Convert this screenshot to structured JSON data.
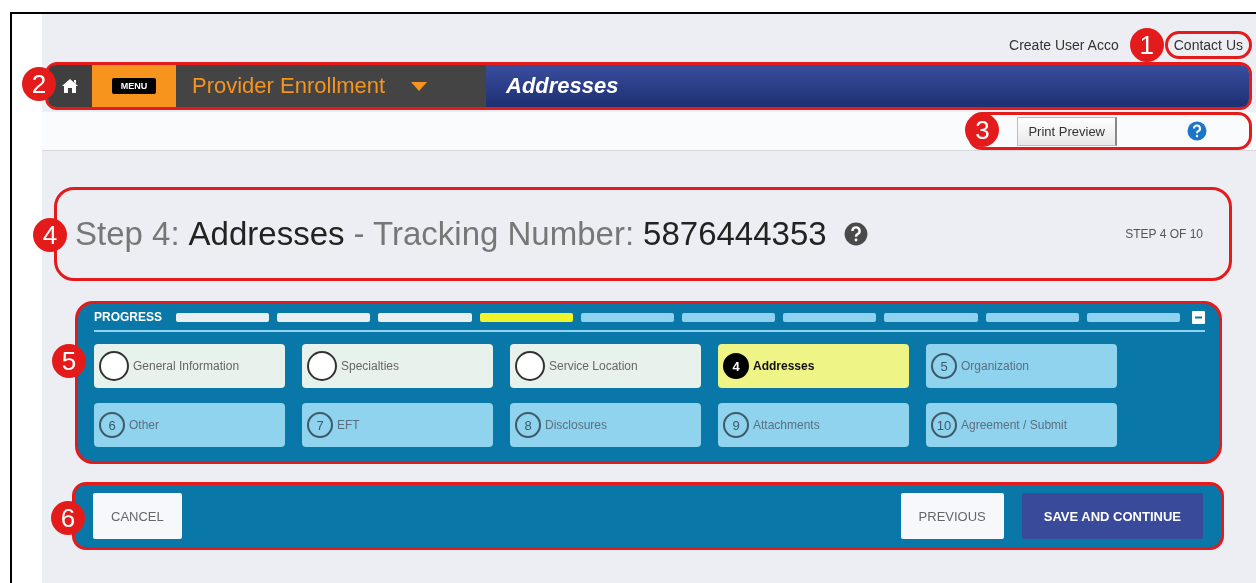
{
  "top_links": [
    {
      "label": "Create User Acco"
    },
    {
      "label": "Contact Us",
      "callout": "1"
    }
  ],
  "nav": {
    "callout": "2",
    "menu_label": "MENU",
    "app_title": "Provider Enrollment",
    "page_title": "Addresses"
  },
  "toolbar": {
    "callout": "3",
    "print_button": "Print Preview"
  },
  "step_header": {
    "callout": "4",
    "step_label": "Step 4:",
    "page_name": "Addresses",
    "tracking_label": "- Tracking Number:",
    "tracking_number": "5876444353",
    "step_count": "STEP 4 OF 10"
  },
  "progress": {
    "callout": "5",
    "title": "PROGRESS",
    "steps": [
      {
        "label": "General Information",
        "completed": true,
        "selected": false
      },
      {
        "label": "Specialties",
        "completed": true,
        "selected": false
      },
      {
        "label": "Service Location",
        "completed": true,
        "selected": false
      },
      {
        "number": "4",
        "label": "Addresses",
        "selected": true
      },
      {
        "number": "5",
        "label": "Organization",
        "completed": false,
        "selected": false
      },
      {
        "number": "6",
        "label": "Other",
        "completed": false,
        "selected": false
      },
      {
        "number": "7",
        "label": "EFT",
        "completed": false,
        "selected": false
      },
      {
        "number": "8",
        "label": "Disclosures",
        "completed": false,
        "selected": false
      },
      {
        "number": "9",
        "label": "Attachments",
        "completed": false,
        "selected": false
      },
      {
        "number": "10",
        "label": "Agreement / Submit",
        "completed": false,
        "selected": false
      }
    ]
  },
  "actions": {
    "callout": "6",
    "cancel": "CANCEL",
    "previous": "PREVIOUS",
    "save": "SAVE AND CONTINUE"
  }
}
